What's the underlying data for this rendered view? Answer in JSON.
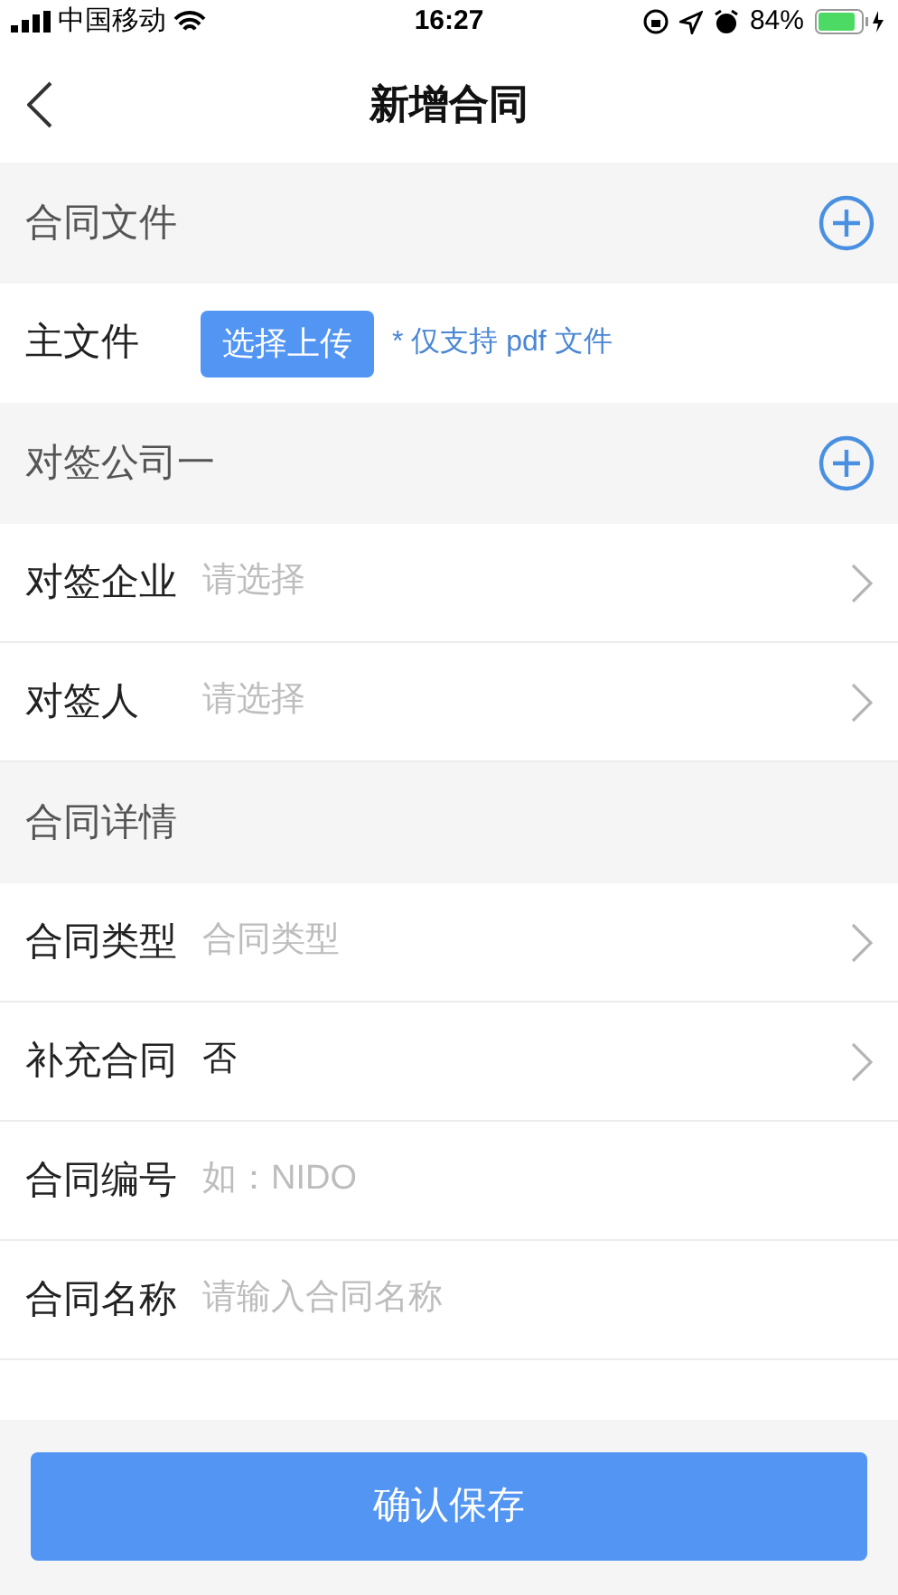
{
  "status_bar": {
    "carrier": "中国移动",
    "time": "16:27",
    "battery": "84%"
  },
  "nav": {
    "title": "新增合同"
  },
  "sections": [
    {
      "title": "合同文件",
      "has_add": true,
      "rows": [
        {
          "kind": "upload",
          "label": "主文件",
          "button": "选择上传",
          "hint": "* 仅支持 pdf 文件"
        }
      ]
    },
    {
      "title": "对签公司一",
      "has_add": true,
      "rows": [
        {
          "kind": "select",
          "label": "对签企业",
          "placeholder": "请选择"
        },
        {
          "kind": "select",
          "label": "对签人",
          "placeholder": "请选择"
        }
      ]
    },
    {
      "title": "合同详情",
      "has_add": false,
      "rows": [
        {
          "kind": "select",
          "label": "合同类型",
          "placeholder": "合同类型"
        },
        {
          "kind": "select",
          "label": "补充合同",
          "value": "否"
        },
        {
          "kind": "input",
          "label": "合同编号",
          "placeholder": "如：NIDO"
        },
        {
          "kind": "input",
          "label": "合同名称",
          "placeholder": "请输入合同名称"
        }
      ]
    }
  ],
  "footer": {
    "button": "确认保存"
  }
}
